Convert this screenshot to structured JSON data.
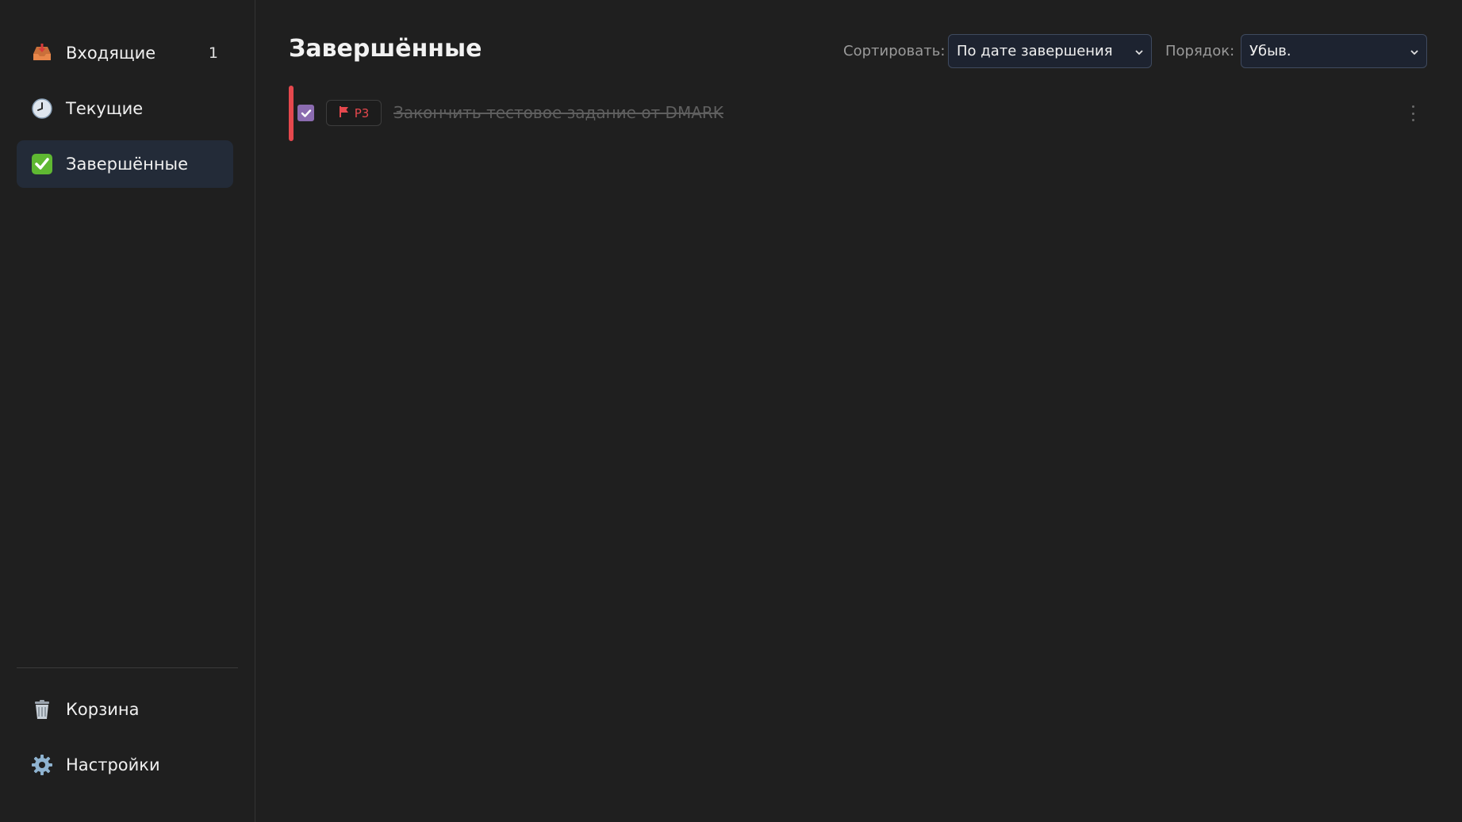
{
  "sidebar": {
    "items": [
      {
        "label": "Входящие",
        "icon": "inbox-tray-icon",
        "count": "1"
      },
      {
        "label": "Текущие",
        "icon": "clock-icon"
      },
      {
        "label": "Завершённые",
        "icon": "check-mark-button-icon",
        "active": true
      }
    ],
    "bottom": [
      {
        "label": "Корзина",
        "icon": "trash-can-icon"
      },
      {
        "label": "Настройки",
        "icon": "gear-icon"
      }
    ]
  },
  "main": {
    "title": "Завершённые",
    "sort_label": "Сортировать:",
    "sort_value": "По дате завершения",
    "order_label": "Порядок:",
    "order_value": "Убыв."
  },
  "tasks": [
    {
      "title": "Закончить тестовое задание от DMARK",
      "priority": "P3",
      "completed": true,
      "priority_color": "#e5484d"
    }
  ],
  "colors": {
    "accent_active": "#232b38",
    "priority_red": "#e5484d",
    "checkbox": "#8b6bb0",
    "background": "#1f1f1f"
  }
}
